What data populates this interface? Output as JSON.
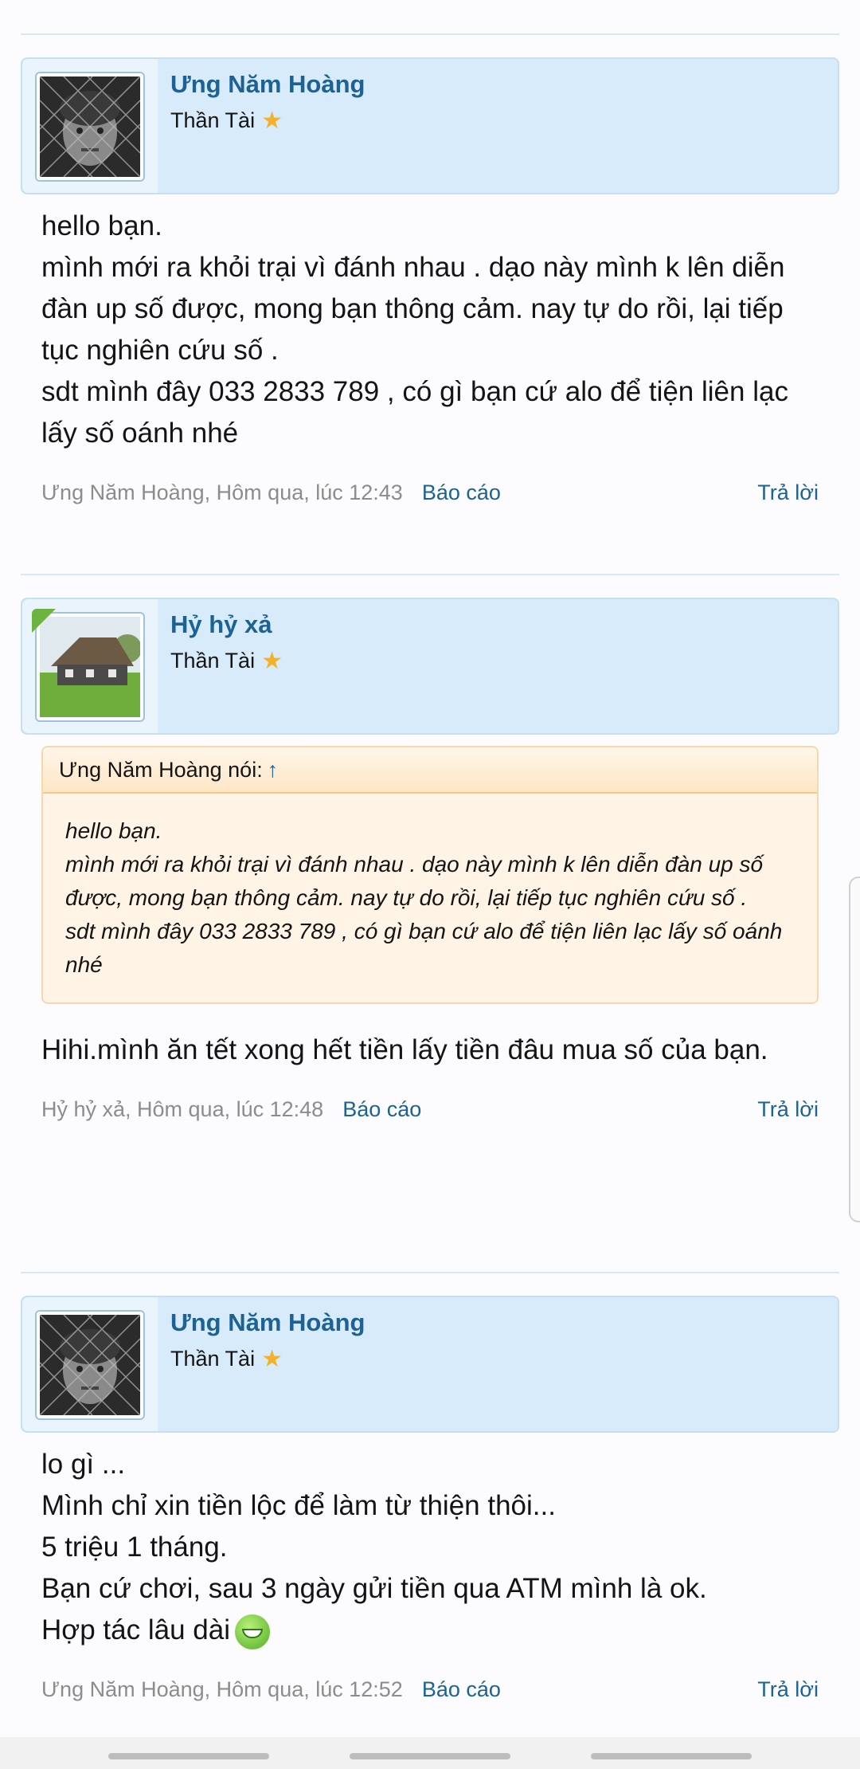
{
  "posts": [
    {
      "username": "Ưng Năm Hoàng",
      "usertitle": "Thần Tài",
      "avatar": "boy-behind-fence-photo",
      "message": [
        "hello bạn.",
        "mình mới ra khỏi trại vì đánh nhau . dạo này mình k lên diễn đàn up số được, mong bạn thông cảm. nay tự do rồi, lại tiếp tục nghiên cứu số .",
        "sdt mình đây 033 2833 789 , có gì bạn cứ alo để tiện liên lạc lấy số oánh nhé"
      ],
      "meta": "Ưng Năm Hoàng, Hôm qua, lúc 12:43",
      "report": "Báo cáo",
      "reply": "Trả lời"
    },
    {
      "username": "Hỷ hỷ xả",
      "usertitle": "Thần Tài",
      "avatar": "country-house-photo",
      "quote": {
        "author": "Ưng Năm Hoàng nói:",
        "arrow": "↑",
        "lines": [
          "hello bạn.",
          "mình mới ra khỏi trại vì đánh nhau . dạo này mình k lên diễn đàn up số được, mong bạn thông cảm. nay tự do rồi, lại tiếp tục nghiên cứu số .",
          "sdt mình đây 033 2833 789 , có gì bạn cứ alo để tiện liên lạc lấy số oánh nhé"
        ]
      },
      "message": [
        "Hihi.mình ăn tết xong hết tiền lấy tiền đâu mua số của bạn."
      ],
      "meta": "Hỷ hỷ xả, Hôm qua, lúc 12:48",
      "report": "Báo cáo",
      "reply": "Trả lời"
    },
    {
      "username": "Ưng Năm Hoàng",
      "usertitle": "Thần Tài",
      "avatar": "boy-behind-fence-photo",
      "message": [
        "lo gì ...",
        "Mình chỉ xin tiền lộc để làm từ thiện thôi...",
        "5 triệu 1 tháng.",
        "Bạn cứ chơi, sau 3 ngày gửi tiền qua ATM mình là ok.",
        "Hợp tác lâu dài"
      ],
      "emoji": "grin-emoji",
      "meta": "Ưng Năm Hoàng, Hôm qua, lúc 12:52",
      "report": "Báo cáo",
      "reply": "Trả lời"
    }
  ],
  "icons": {
    "star": "star-icon",
    "quote_arrow": "up-arrow-icon"
  },
  "colors": {
    "link": "#1d6294",
    "header_bg": "#d8ebfa",
    "quote_bg": "#fff4e6",
    "star": "#f2b22a"
  }
}
